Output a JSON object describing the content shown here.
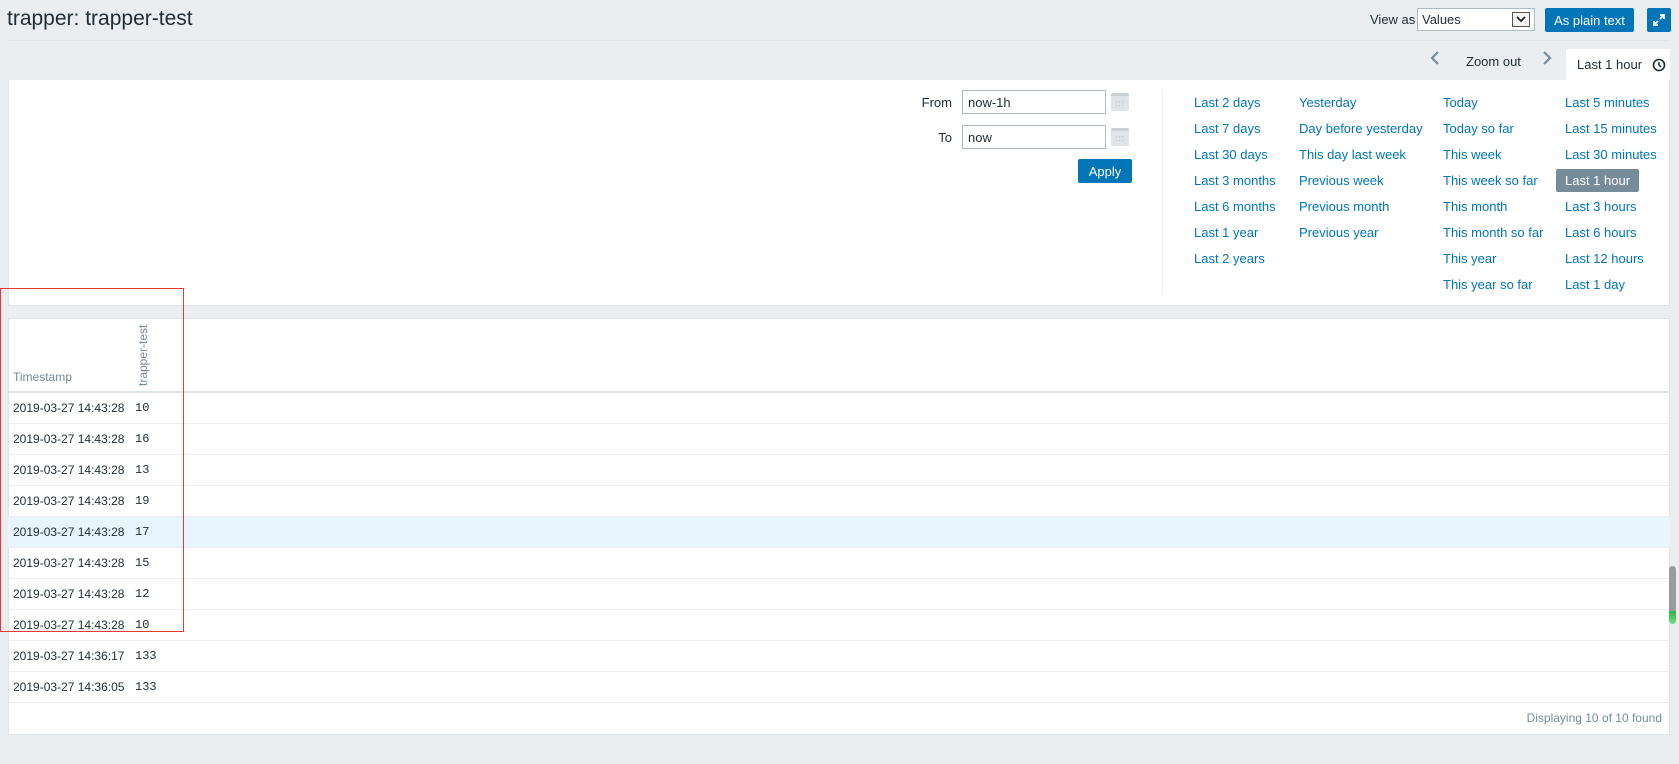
{
  "header": {
    "title": "trapper: trapper-test",
    "view_as_label": "View as",
    "view_as_value": "Values",
    "plain_text_button": "As plain text",
    "fullscreen_icon": "fullscreen-icon"
  },
  "timeline": {
    "prev_icon": "chevron-left-icon",
    "zoom_out": "Zoom out",
    "next_icon": "chevron-right-icon",
    "active_tab": "Last 1 hour",
    "clock_icon": "clock-icon"
  },
  "filter": {
    "from_label": "From",
    "from_value": "now-1h",
    "to_label": "To",
    "to_value": "now",
    "apply": "Apply",
    "quick_ranges": [
      [
        "Last 2 days",
        "Last 7 days",
        "Last 30 days",
        "Last 3 months",
        "Last 6 months",
        "Last 1 year",
        "Last 2 years"
      ],
      [
        "Yesterday",
        "Day before yesterday",
        "This day last week",
        "Previous week",
        "Previous month",
        "Previous year"
      ],
      [
        "Today",
        "Today so far",
        "This week",
        "This week so far",
        "This month",
        "This month so far",
        "This year",
        "This year so far"
      ],
      [
        "Last 5 minutes",
        "Last 15 minutes",
        "Last 30 minutes",
        "Last 1 hour",
        "Last 3 hours",
        "Last 6 hours",
        "Last 12 hours",
        "Last 1 day"
      ]
    ],
    "selected_range": "Last 1 hour"
  },
  "table": {
    "columns": [
      "Timestamp",
      "trapper-test"
    ],
    "rows": [
      {
        "timestamp": "2019-03-27 14:43:28",
        "value": "10"
      },
      {
        "timestamp": "2019-03-27 14:43:28",
        "value": "16"
      },
      {
        "timestamp": "2019-03-27 14:43:28",
        "value": "13"
      },
      {
        "timestamp": "2019-03-27 14:43:28",
        "value": "19"
      },
      {
        "timestamp": "2019-03-27 14:43:28",
        "value": "17"
      },
      {
        "timestamp": "2019-03-27 14:43:28",
        "value": "15"
      },
      {
        "timestamp": "2019-03-27 14:43:28",
        "value": "12"
      },
      {
        "timestamp": "2019-03-27 14:43:28",
        "value": "10"
      },
      {
        "timestamp": "2019-03-27 14:36:17",
        "value": "133"
      },
      {
        "timestamp": "2019-03-27 14:36:05",
        "value": "133"
      }
    ],
    "highlighted_row_index": 4,
    "footer": "Displaying 10 of 10 found"
  },
  "colors": {
    "accent": "#0275b8",
    "selected_range_bg": "#768d99",
    "row_highlight": "#e8f5ff",
    "annotation_box": "#e53935"
  }
}
